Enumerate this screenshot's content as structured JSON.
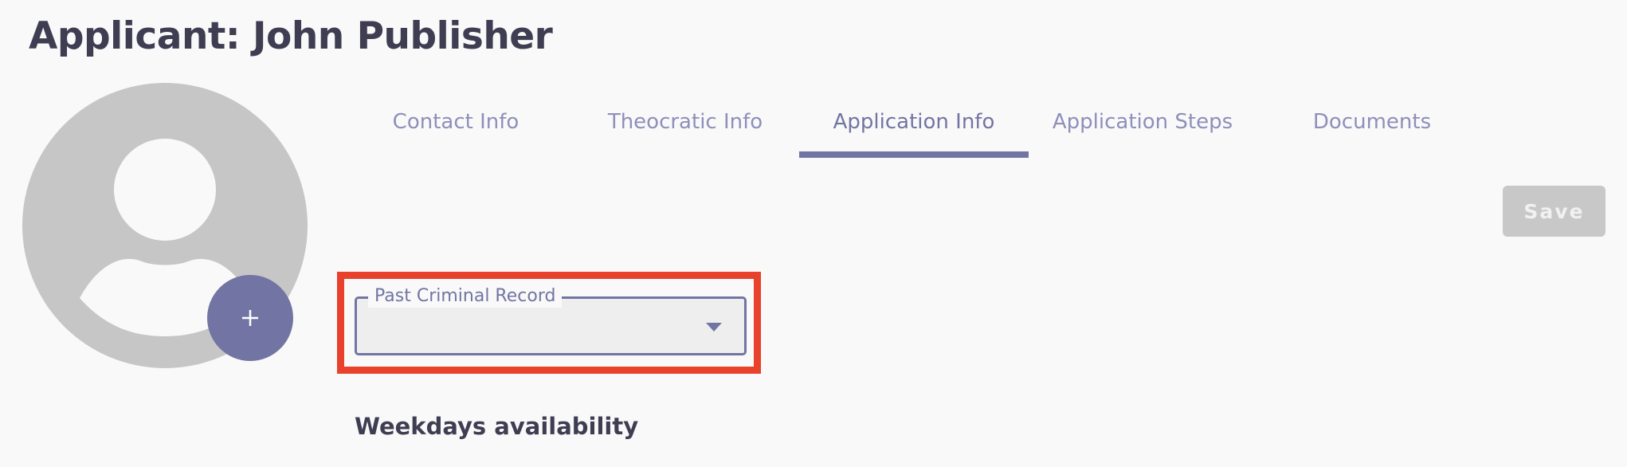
{
  "page": {
    "title": "Applicant: John Publisher"
  },
  "avatar": {
    "icon": "user-placeholder-icon",
    "add_icon": "plus-icon",
    "add_label": "+"
  },
  "tabs": [
    {
      "label": "Contact Info",
      "active": false
    },
    {
      "label": "Theocratic Info",
      "active": false
    },
    {
      "label": "Application Info",
      "active": true
    },
    {
      "label": "Application Steps",
      "active": false
    },
    {
      "label": "Documents",
      "active": false
    }
  ],
  "toolbar": {
    "save_label": "Save",
    "save_enabled": false
  },
  "form": {
    "past_criminal_record": {
      "label": "Past Criminal Record",
      "value": "",
      "icon": "chevron-down-icon"
    },
    "weekdays_heading": "Weekdays availability"
  },
  "colors": {
    "accent": "#7275a3",
    "tab_text": "#8e8fba",
    "title_text": "#3f3d52",
    "avatar_bg": "#c6c6c6",
    "highlight": "#e8412c",
    "save_disabled_bg": "#c8c8c8",
    "page_bg": "#f9f9f9"
  }
}
